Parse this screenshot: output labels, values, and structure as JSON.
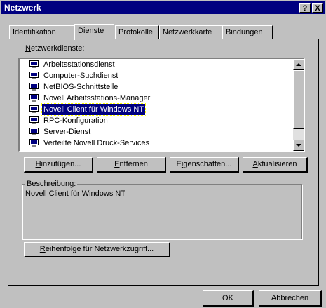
{
  "window": {
    "title": "Netzwerk",
    "help_label": "?",
    "close_label": "X"
  },
  "tabs": [
    {
      "label": "Identifikation",
      "active": false
    },
    {
      "label": "Dienste",
      "active": true
    },
    {
      "label": "Protokolle",
      "active": false
    },
    {
      "label": "Netzwerkkarte",
      "active": false
    },
    {
      "label": "Bindungen",
      "active": false
    }
  ],
  "services": {
    "label_prefix": "",
    "label_accel": "N",
    "label_rest": "etzwerkdienste:",
    "items": [
      {
        "label": "Arbeitsstationsdienst",
        "selected": false
      },
      {
        "label": "Computer-Suchdienst",
        "selected": false
      },
      {
        "label": "NetBIOS-Schnittstelle",
        "selected": false
      },
      {
        "label": "Novell Arbeitsstations-Manager",
        "selected": false
      },
      {
        "label": "Novell Client für Windows NT",
        "selected": true
      },
      {
        "label": "RPC-Konfiguration",
        "selected": false
      },
      {
        "label": "Server-Dienst",
        "selected": false
      },
      {
        "label": "Verteilte Novell Druck-Services",
        "selected": false
      }
    ]
  },
  "buttons": {
    "add": {
      "prefix": "",
      "accel": "H",
      "rest": "inzufügen..."
    },
    "remove": {
      "prefix": "",
      "accel": "E",
      "rest": "ntfernen"
    },
    "properties": {
      "prefix": "E",
      "accel": "i",
      "rest": "genschaften..."
    },
    "refresh": {
      "prefix": "",
      "accel": "A",
      "rest": "ktualisieren"
    },
    "order": {
      "prefix": "",
      "accel": "R",
      "rest": "eihenfolge für Netzwerkzugriff..."
    },
    "ok": "OK",
    "cancel": "Abbrechen"
  },
  "description": {
    "label": "Beschreibung:",
    "text": "Novell Client für Windows NT"
  },
  "colors": {
    "title_bar": "#000080",
    "face": "#c0c0c0",
    "selection": "#000080"
  },
  "icons": {
    "service_item": "network-service-icon",
    "scroll_up": "arrow-up-icon",
    "scroll_down": "arrow-down-icon"
  }
}
